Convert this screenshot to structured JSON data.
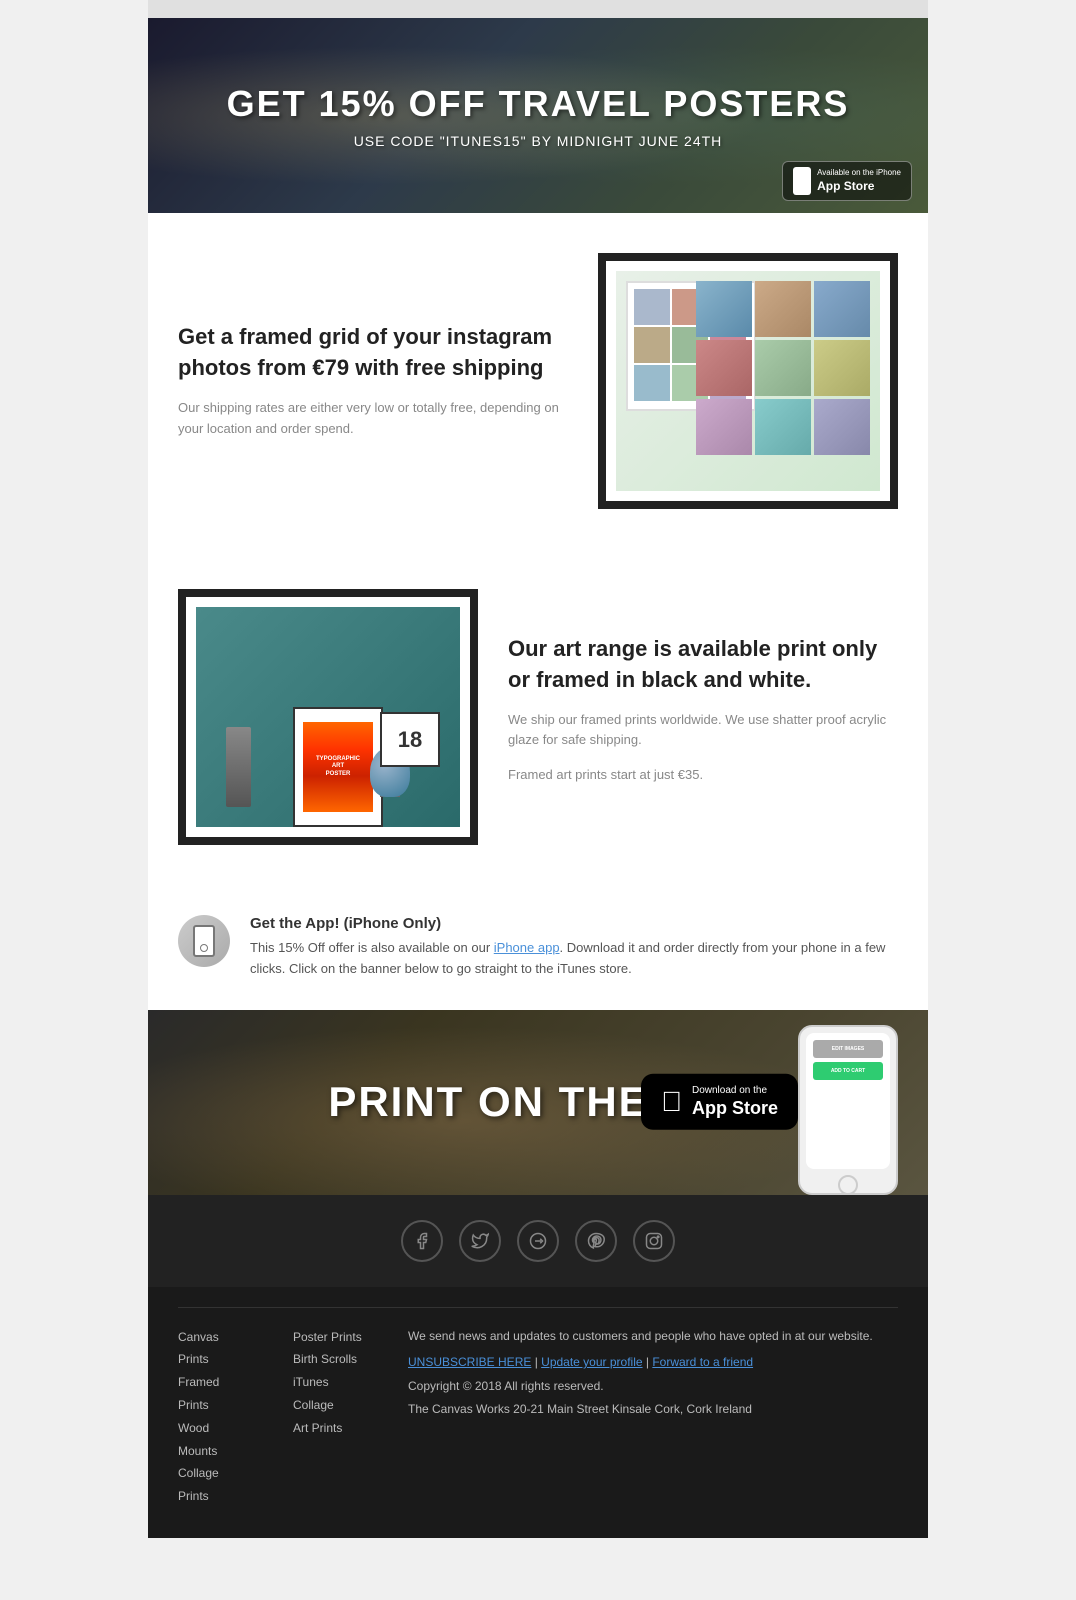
{
  "topBar": {},
  "heroBanner": {
    "title": "GET 15% OFF TRAVEL POSTERS",
    "subtitle": "USE CODE \"ITUNES15\" BY MIDNIGHT JUNE 24TH",
    "appstore": {
      "available": "Available on the iPhone",
      "store": "App Store"
    }
  },
  "sectionFramed": {
    "heading": "Get a framed grid of your instagram photos from €79 with free shipping",
    "body": "Our shipping rates are either very low or totally free, depending on your location and order spend."
  },
  "sectionArt": {
    "heading": "Our art range is available print only or framed in black and white.",
    "body": "We ship our framed prints worldwide.  We use shatter proof acrylic glaze for safe shipping.",
    "priceNote": "Framed art prints start at just €35."
  },
  "sectionApp": {
    "heading": "Get the App! (iPhone Only)",
    "body": "This 15% Off offer is also available on our ",
    "linkText": "iPhone app",
    "bodyAfter": ".  Download it and order directly from your phone in a few clicks.  Click on the banner below to go straight to the iTunes store."
  },
  "appBanner": {
    "title": "PRINT ON THE GO!",
    "downloadLabel": "Download on the",
    "storeLabel": "App Store",
    "editImages": "EDIT IMAGES",
    "addToCart": "ADD TO CART"
  },
  "social": {
    "icons": [
      "facebook",
      "twitter",
      "google-plus",
      "pinterest",
      "instagram"
    ]
  },
  "footer": {
    "col1Links": [
      "Canvas",
      "Prints",
      "Framed Prints",
      "Wood Mounts",
      "Collage",
      "Prints"
    ],
    "col2Links": [
      "Poster Prints",
      "Birth Scrolls",
      "iTunes",
      "Collage",
      "Art Prints"
    ],
    "infoText": "We send news and updates to customers and people who have opted in at our website.",
    "unsubscribeLabel": "UNSUBSCRIBE HERE",
    "updateLabel": "Update your profile",
    "forwardLabel": "Forward to a friend",
    "copyright": "Copyright © 2018 All rights reserved.",
    "address": "The Canvas Works 20-21 Main Street Kinsale Cork, Cork Ireland"
  }
}
